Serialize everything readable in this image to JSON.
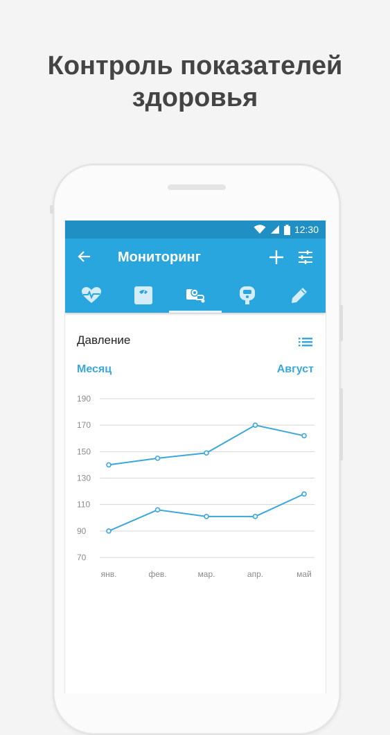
{
  "headline": {
    "line1": "Контроль показателей",
    "line2": "здоровья"
  },
  "statusbar": {
    "time": "12:30",
    "icons": [
      "wifi-icon",
      "signal-icon",
      "battery-icon"
    ]
  },
  "appbar": {
    "title": "Мониторинг",
    "back_icon": "arrow-back-icon",
    "add_icon": "plus-icon",
    "filter_icon": "sliders-icon"
  },
  "tabs": [
    {
      "icon": "heart-pulse-icon",
      "active": false
    },
    {
      "icon": "scale-icon",
      "active": false
    },
    {
      "icon": "blood-pressure-icon",
      "active": true
    },
    {
      "icon": "glucometer-icon",
      "active": false
    },
    {
      "icon": "pencil-icon",
      "active": false
    }
  ],
  "card": {
    "title": "Давление",
    "list_icon": "list-icon",
    "period": "Месяц",
    "month": "Август"
  },
  "colors": {
    "statusbar": "#1f8fc4",
    "appbar": "#2aa6df",
    "accent": "#3aa7dc",
    "line": "#3aa7dc"
  },
  "chart_data": {
    "type": "line",
    "categories": [
      "янв.",
      "фев.",
      "мар.",
      "апр.",
      "май"
    ],
    "yticks": [
      190,
      170,
      150,
      130,
      110,
      90,
      70
    ],
    "series": [
      {
        "values": [
          140,
          145,
          149,
          170,
          162
        ]
      },
      {
        "values": [
          90,
          106,
          101,
          101,
          118
        ]
      }
    ]
  }
}
